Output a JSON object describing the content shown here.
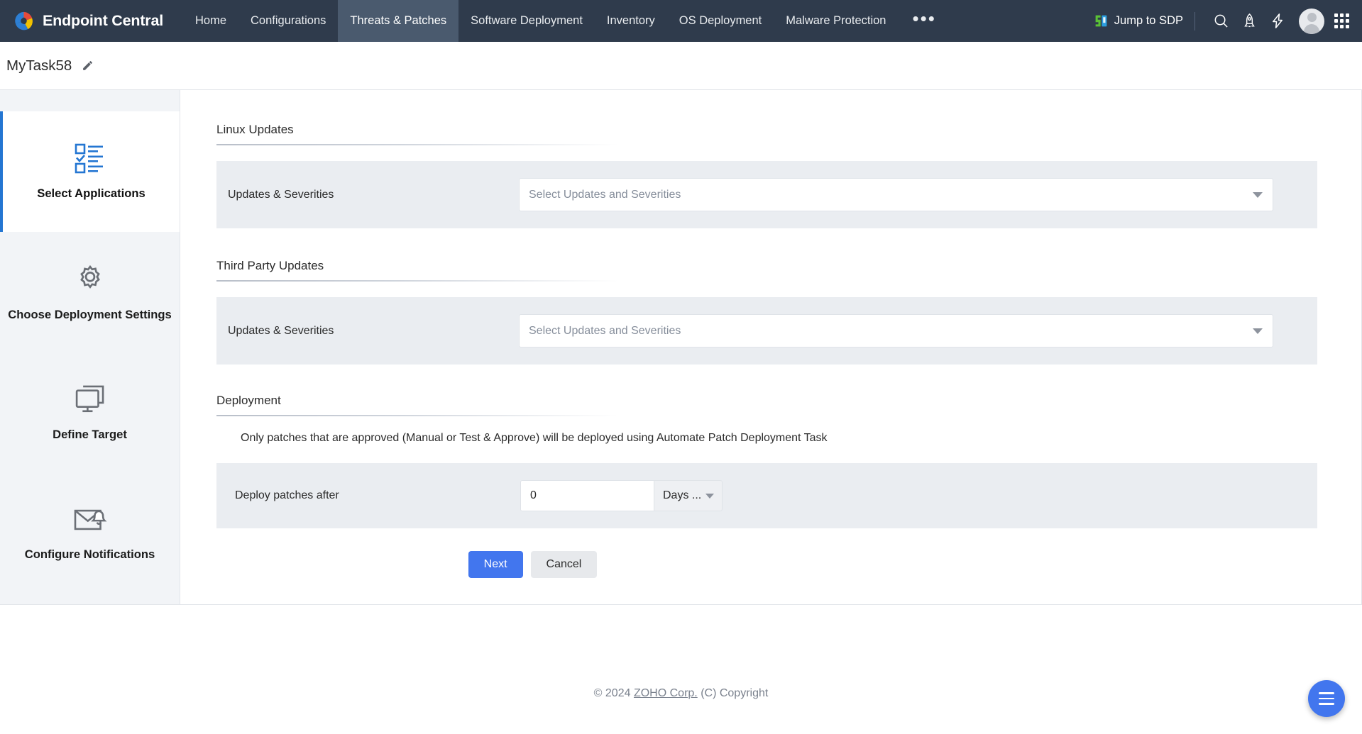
{
  "topnav": {
    "brand": "Endpoint Central",
    "brand_logo_icon": "endpoint-central-logo",
    "items": [
      {
        "label": "Home",
        "active": false
      },
      {
        "label": "Configurations",
        "active": false
      },
      {
        "label": "Threats & Patches",
        "active": true
      },
      {
        "label": "Software Deployment",
        "active": false
      },
      {
        "label": "Inventory",
        "active": false
      },
      {
        "label": "OS Deployment",
        "active": false
      },
      {
        "label": "Malware Protection",
        "active": false
      }
    ],
    "more_label": "•••",
    "jump_to_sdp": "Jump to SDP",
    "jump_to_sdp_icon": "sdp-logo-icon",
    "icons": [
      "search-icon",
      "rocket-icon",
      "lightning-icon",
      "avatar",
      "app-grid-icon"
    ]
  },
  "page": {
    "task_name": "MyTask58",
    "edit_icon": "pencil-icon"
  },
  "sidebar": {
    "steps": [
      {
        "label": "Select Applications",
        "icon": "checklist-icon",
        "active": true
      },
      {
        "label": "Choose Deployment Settings",
        "icon": "gear-icon",
        "active": false
      },
      {
        "label": "Define Target",
        "icon": "monitor-icon",
        "active": false
      },
      {
        "label": "Configure Notifications",
        "icon": "mail-bell-icon",
        "active": false
      }
    ]
  },
  "main": {
    "sections": [
      {
        "heading": "Linux Updates",
        "field_label": "Updates & Severities",
        "select_placeholder": "Select Updates and Severities",
        "select_value": ""
      },
      {
        "heading": "Third Party Updates",
        "field_label": "Updates & Severities",
        "select_placeholder": "Select Updates and Severities",
        "select_value": ""
      }
    ],
    "deployment": {
      "heading": "Deployment",
      "note": "Only patches that are approved (Manual or Test & Approve) will be deployed using Automate Patch Deployment Task",
      "deploy_label": "Deploy patches after",
      "deploy_value": "0",
      "deploy_placeholder": "0",
      "unit_label": "Days ..."
    },
    "buttons": {
      "next": "Next",
      "cancel": "Cancel"
    }
  },
  "footer": {
    "prefix": "© 2024 ",
    "link": "ZOHO Corp.",
    "suffix": " (C) Copyright"
  },
  "fab": {
    "icon": "menu-hamburger-icon"
  },
  "colors": {
    "nav_bg": "#2f3b4c",
    "nav_active": "#4a5a6e",
    "accent_blue": "#4276ee",
    "step_active_bar": "#2476d2",
    "panel_gray": "#eaedf1",
    "sidebar_bg": "#f2f4f7"
  }
}
